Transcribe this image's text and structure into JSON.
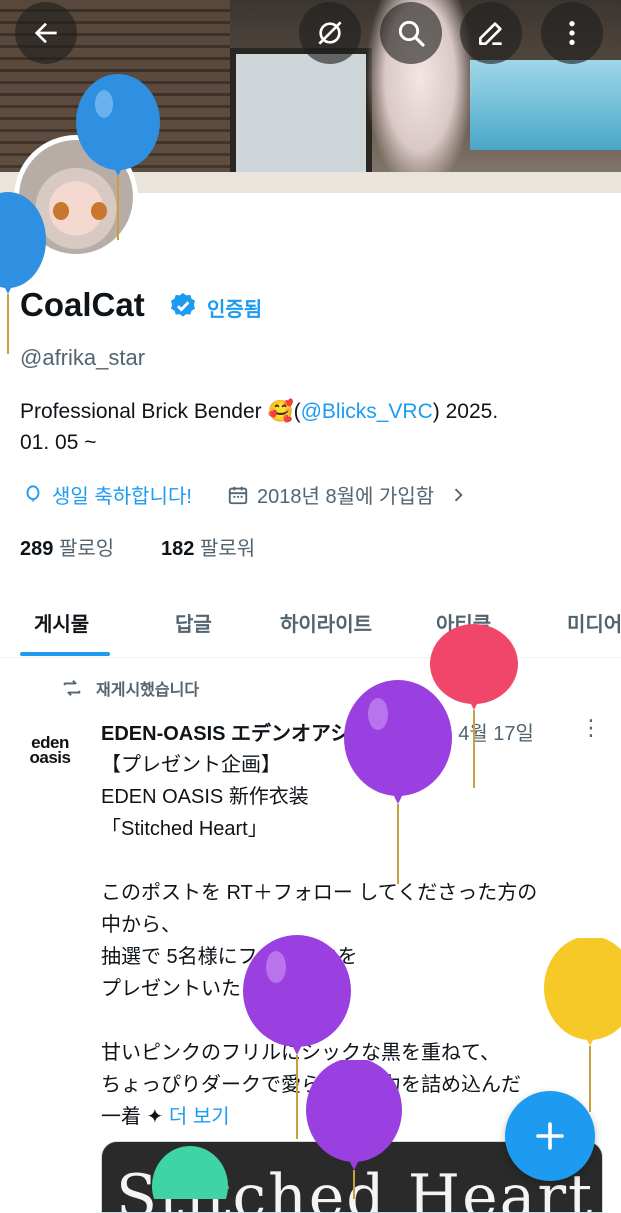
{
  "header": {
    "back_label": "back",
    "actions": [
      "grok-icon",
      "search-icon",
      "edit-icon",
      "more-icon"
    ]
  },
  "profile": {
    "name": "CoalCat",
    "verified_label": "인증됨",
    "handle": "@afrika_star",
    "bio_prefix": "Professional Brick Bender 🥰(",
    "bio_link": "@Blicks_VRC",
    "bio_suffix": ") 2025.",
    "bio_line2": "01. 05 ~",
    "birthday": "생일 축하합니다!",
    "joined": "2018년 8월에 가입함",
    "following_count": "289",
    "following_label": "팔로잉",
    "followers_count": "182",
    "followers_label": "팔로워"
  },
  "tabs": [
    "게시물",
    "답글",
    "하이라이트",
    "아티클",
    "미디어"
  ],
  "post": {
    "repost_label": "재게시했습니다",
    "avatar_line1": "eden",
    "avatar_line2": "oasis",
    "author": "EDEN-OASIS エデンオアシ...",
    "date": "· 4월 17일",
    "more": "⋮",
    "lines": [
      "【プレゼント企画】",
      "EDEN OASIS 新作衣装",
      "「Stitched Heart」",
      "",
      "このポストを RT＋フォロー してくださった方の",
      "中から、",
      "抽選で 5名様にフルパックを",
      "プレゼントいたします 🎁",
      "",
      "甘いピンクのフリルにシックな黒を重ねて、",
      "ちょっぴりダークで愛らしい魅力を詰め込んだ"
    ],
    "last_line": "一着 ✦",
    "more_label": "더 보기",
    "media_title": "Stitched Heart"
  },
  "fab_label": "+",
  "colors": {
    "accent": "#1d9bf0",
    "text": "#0f1419",
    "secondary": "#536471",
    "balloon_blue": "#2f8fe0",
    "balloon_purple": "#9a3fe0",
    "balloon_pink": "#f0466a",
    "balloon_yellow": "#f7c928"
  }
}
